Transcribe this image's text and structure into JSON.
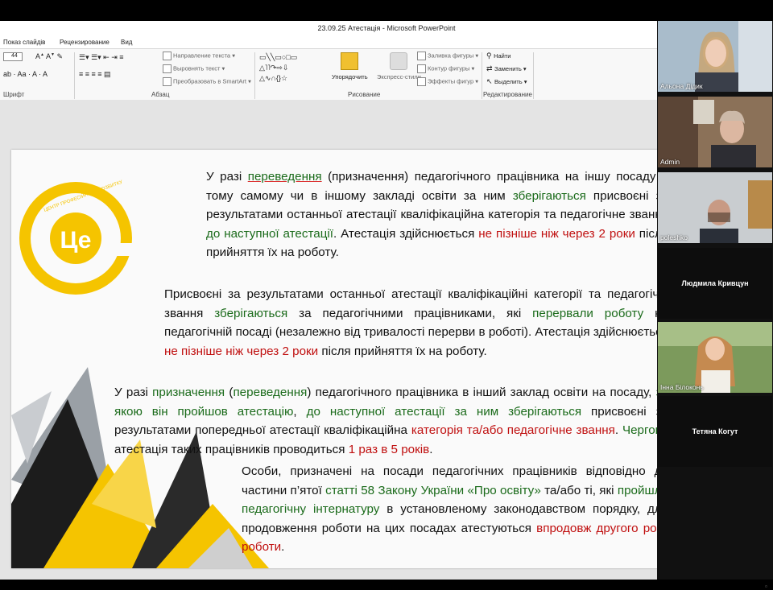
{
  "window": {
    "title": "23.09.25 Атестація  -  Microsoft PowerPoint"
  },
  "menu": [
    "Показ слайдів",
    "Рецензирование",
    "Вид"
  ],
  "ribbon": {
    "groups": {
      "font": "Шрифт",
      "paragraph": "Абзац",
      "drawing": "Рисование",
      "editing": "Редактирование"
    },
    "font_size": "44",
    "paragraph_items": {
      "text_direction": "Направление текста",
      "align_text": "Выровнять текст",
      "smartart": "Преобразовать в SmartArt"
    },
    "drawing_items": {
      "arrange": "Упорядочить",
      "quick_styles": "Экспресс-стили",
      "shape_fill": "Заливка фигуры",
      "shape_outline": "Контур фигуры",
      "shape_effects": "Эффекты фигур"
    },
    "editing_items": {
      "find": "Найти",
      "replace": "Заменить",
      "select": "Выделить"
    }
  },
  "slide": {
    "logo_text": "Це",
    "logo_ring_text": "ЦЕНТР ПРОФЕСІЙНОГО РОЗВИТКУ",
    "p1": {
      "t1": "У разі ",
      "t2": "переведення",
      "t3": " (призначення) педагогічного працівника на іншу посаду в тому самому чи в іншому закладі освіти за ним ",
      "t4": "зберігаються",
      "t5": " присвоєні за результатами останньої атестації кваліфікаційна категорія та педагогічне звання ",
      "t6": "до наступної атестації",
      "t7": ". Атестація здійснюється ",
      "t8": "не пізніше ніж через 2 роки",
      "t9": " після прийняття їх на роботу."
    },
    "p2": {
      "t1": "Присвоєні за результатами останньої атестації кваліфікаційні категорії та педагогічні звання ",
      "t2": "зберігаються",
      "t3": " за педагогічними працівниками, які ",
      "t4": "перервали роботу",
      "t5": " на педагогічній посаді (незалежно від тривалості перерви в роботі). Атестація здійснюється ",
      "t6": "не пізніше ніж через 2 роки",
      "t7": " після прийняття їх на роботу."
    },
    "p3": {
      "t1": "У разі ",
      "t2": "призначення",
      "t3": " (",
      "t4": "переведення",
      "t5": ") педагогічного працівника в інший заклад освіти на посаду, ",
      "t6": "за якою він пройшов атестацію",
      "t7": ", ",
      "t8": "до наступної атестації за ним зберігаються",
      "t9": " присвоєні за результатами попередньої атестації кваліфікаційна ",
      "t10": "категорія та/або педагогічне звання",
      "t11": ". ",
      "t12": "Чергова",
      "t13": " атестація таких працівників проводиться ",
      "t14": "1 раз в 5 років",
      "t15": "."
    },
    "p4": {
      "t1": "Особи, призначені на посади педагогічних працівників відповідно до частини п’ятої ",
      "t2": "статті 58 Закону України «Про освіту»",
      "t3": " та/або ті, які ",
      "t4": "пройшли педагогічну інтернатуру",
      "t5": " в установленому законодавством порядку, для продовження роботи на цих посадах атестуються ",
      "t6": "впродовж другого року роботи",
      "t7": "."
    }
  },
  "participants": [
    {
      "name": "Альона Дідик",
      "video": true
    },
    {
      "name": "Admin",
      "video": true
    },
    {
      "name": "poleshko",
      "video": true
    },
    {
      "name": "Людмила Кривцун",
      "video": false
    },
    {
      "name": "Інна Білоконь",
      "video": true
    },
    {
      "name": "Тетяна Когут",
      "video": false
    }
  ],
  "colors": {
    "green_text": "#1b6b1b",
    "red_text": "#c01010",
    "logo_yellow": "#f5c400"
  }
}
